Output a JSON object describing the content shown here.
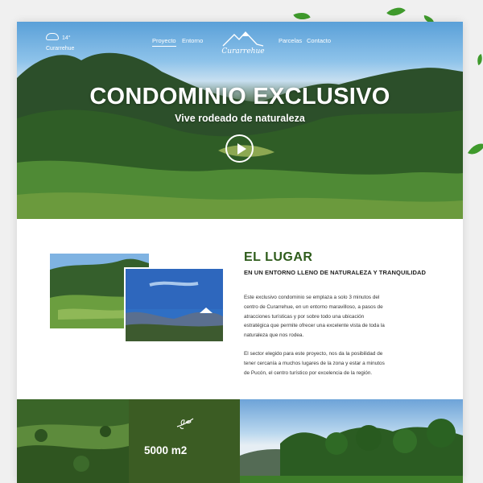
{
  "nav": {
    "temperature": "14°",
    "city": "Curarrehue",
    "links": [
      "Proyecto",
      "Entorno",
      "Parcelas",
      "Contacto"
    ],
    "logo_text": "Curarrehue"
  },
  "hero": {
    "title": "CONDOMINIO EXCLUSIVO",
    "subtitle": "Vive rodeado de naturaleza"
  },
  "lugar": {
    "title": "EL LUGAR",
    "subtitle": "EN UN ENTORNO LLENO DE NATURALEZA Y TRANQUILIDAD",
    "paragraph1": [
      "Este exclusivo condominio se emplaza a solo 3 minutos del",
      "centro de Curarrehue, en un entorno maravilloso, a pasos de",
      "atracciones turísticas y por sobre todo una ubicación",
      "estratégica que permite ofrecer una excelente vista de toda la",
      "naturaleza que nos rodea."
    ],
    "paragraph2": [
      "El sector elegido para este proyecto, nos da la posibilidad de",
      "tener cercanía a muchos lugares de la zona y estar a minutos",
      "de Pucón, el centro turístico por excelencia de la región."
    ]
  },
  "stats": {
    "area": "5000 m2"
  },
  "colors": {
    "brand_green": "#2e5c1b",
    "panel_green": "#3b5c23"
  }
}
